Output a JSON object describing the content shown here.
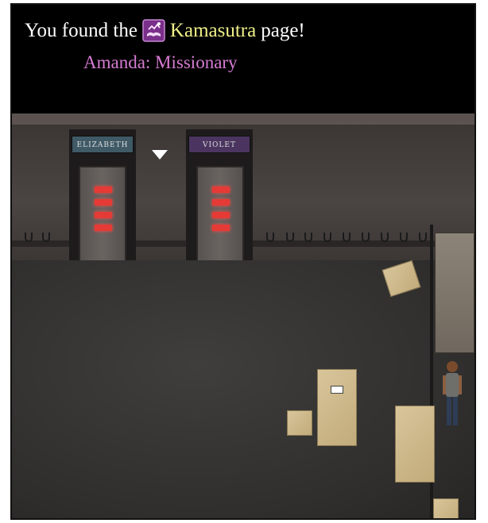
{
  "message": {
    "prefix": "You found the",
    "item_icon": "kamasutra-book-icon",
    "item_name": "Kamasutra",
    "suffix": "page!",
    "entry": "Amanda: Missionary",
    "colors": {
      "text": "#ffffff",
      "item": "#f0f08a",
      "entry": "#d77cd4"
    }
  },
  "scene": {
    "doors": [
      {
        "sign": "ELIZABETH",
        "sign_color": "#3f5a66"
      },
      {
        "sign": "VIOLET",
        "sign_color": "#4b3560"
      }
    ],
    "door_light_color": "#e53a35",
    "selection_marker": "down-arrow-icon"
  }
}
